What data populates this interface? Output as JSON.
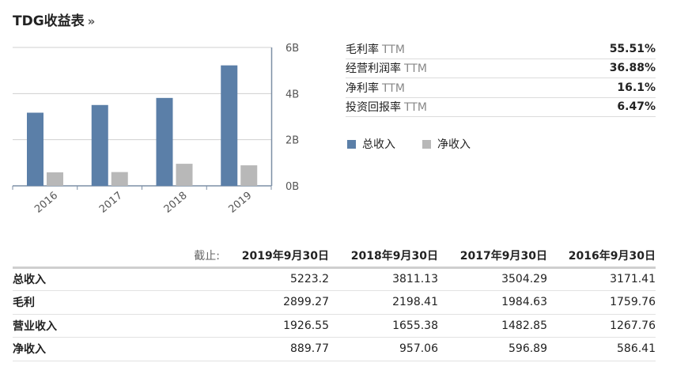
{
  "title": "TDG收益表",
  "title_more": "»",
  "colors": {
    "revenue": "#5b7fa8",
    "net_income": "#b8b8b8",
    "grid": "#cfcfcf"
  },
  "chart_data": {
    "type": "bar",
    "categories": [
      "2016",
      "2017",
      "2018",
      "2019"
    ],
    "series": [
      {
        "name": "总收入",
        "values": [
          3.17141,
          3.50429,
          3.81113,
          5.2232
        ]
      },
      {
        "name": "净收入",
        "values": [
          0.58641,
          0.59689,
          0.95706,
          0.88977
        ]
      }
    ],
    "yticks": [
      "6B",
      "4B",
      "2B",
      "0B"
    ],
    "ylim": [
      0,
      6
    ],
    "grid": true
  },
  "ratios": [
    {
      "label": "毛利率",
      "ttm": "TTM",
      "value": "55.51%"
    },
    {
      "label": "经营利润率",
      "ttm": "TTM",
      "value": "36.88%"
    },
    {
      "label": "净利率",
      "ttm": "TTM",
      "value": "16.1%"
    },
    {
      "label": "投资回报率",
      "ttm": "TTM",
      "value": "6.47%"
    }
  ],
  "legend": [
    {
      "label": "总收入",
      "color": "#5b7fa8"
    },
    {
      "label": "净收入",
      "color": "#b8b8b8"
    }
  ],
  "table": {
    "asof_label": "截止:",
    "columns": [
      "2019年9月30日",
      "2018年9月30日",
      "2017年9月30日",
      "2016年9月30日"
    ],
    "rows": [
      {
        "label": "总收入",
        "values": [
          "5223.2",
          "3811.13",
          "3504.29",
          "3171.41"
        ]
      },
      {
        "label": "毛利",
        "values": [
          "2899.27",
          "2198.41",
          "1984.63",
          "1759.76"
        ]
      },
      {
        "label": "营业收入",
        "values": [
          "1926.55",
          "1655.38",
          "1482.85",
          "1267.76"
        ]
      },
      {
        "label": "净收入",
        "values": [
          "889.77",
          "957.06",
          "596.89",
          "586.41"
        ]
      }
    ]
  }
}
